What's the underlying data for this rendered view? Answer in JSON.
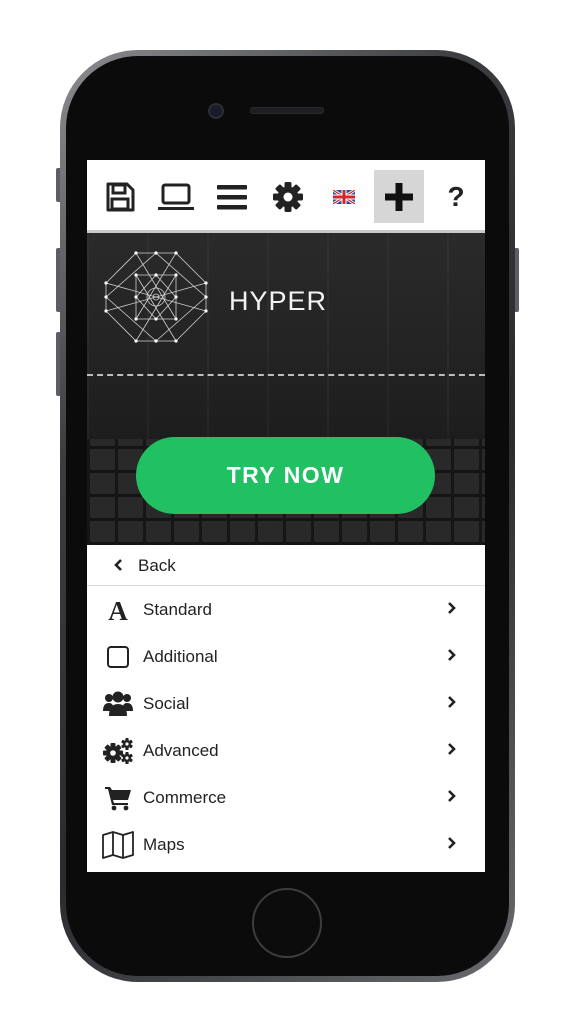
{
  "toolbar": {
    "icons": [
      "save-icon",
      "laptop-icon",
      "menu-icon",
      "gear-icon",
      "uk-flag-icon",
      "plus-icon",
      "question-icon"
    ],
    "help_label": "?"
  },
  "hero": {
    "brand": "HYPER",
    "cta_label": "TRY NOW",
    "cta_color": "#21c062"
  },
  "menu": {
    "back_label": "Back",
    "items": [
      {
        "label": "Standard",
        "icon": "letter-a-icon"
      },
      {
        "label": "Additional",
        "icon": "square-icon"
      },
      {
        "label": "Social",
        "icon": "users-icon"
      },
      {
        "label": "Advanced",
        "icon": "gears-icon"
      },
      {
        "label": "Commerce",
        "icon": "cart-icon"
      },
      {
        "label": "Maps",
        "icon": "map-icon"
      }
    ]
  }
}
